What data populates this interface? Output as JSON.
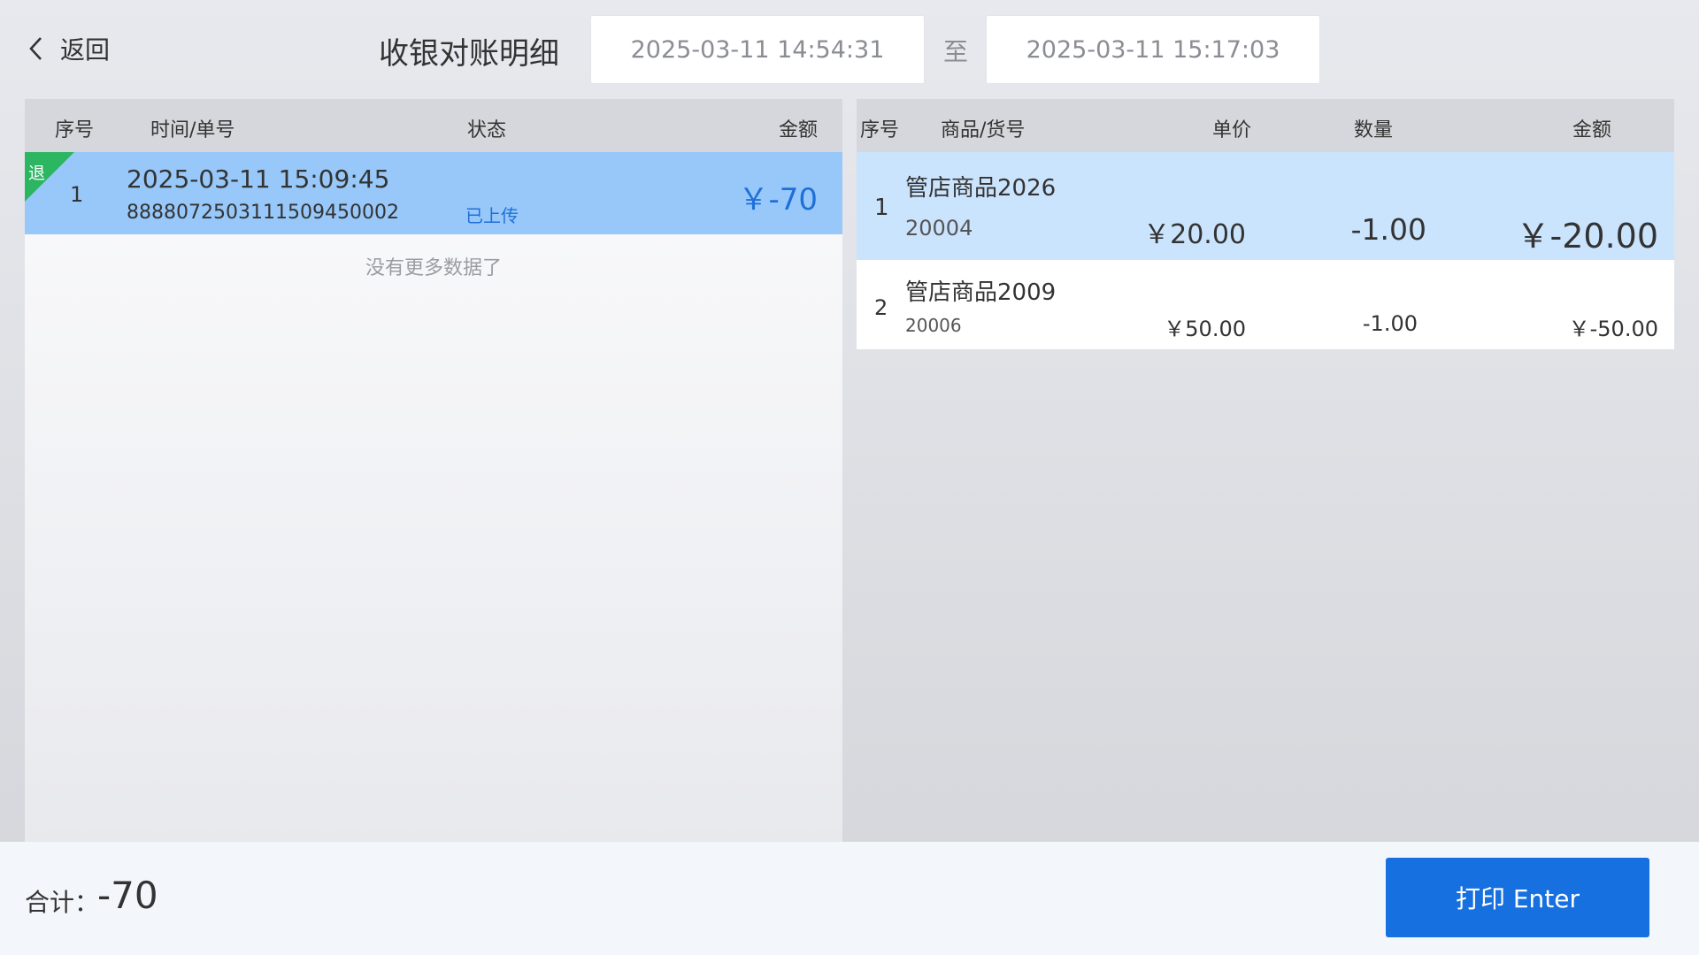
{
  "header": {
    "back_label": "返回",
    "title": "收银对账明细",
    "start_time": "2025-03-11 14:54:31",
    "to_label": "至",
    "end_time": "2025-03-11 15:17:03"
  },
  "orders": {
    "columns": {
      "seq": "序号",
      "time_no": "时间/单号",
      "status": "状态",
      "amount": "金额"
    },
    "rows": [
      {
        "tag": "退",
        "seq": "1",
        "time": "2025-03-11 15:09:45",
        "order_no": "888807250311150945000​2",
        "status": "已上传",
        "amount": "￥-70",
        "selected": true
      }
    ],
    "empty_hint": "没有更多数据了"
  },
  "items": {
    "columns": {
      "seq": "序号",
      "name_code": "商品/货号",
      "price": "单价",
      "qty": "数量",
      "amount": "金额"
    },
    "rows": [
      {
        "seq": "1",
        "name": "管店商品2026",
        "code": "20004",
        "price": "￥20.00",
        "qty": "-1.00",
        "amount": "￥-20.00",
        "selected": true
      },
      {
        "seq": "2",
        "name": "管店商品2009",
        "code": "20006",
        "price": "￥50.00",
        "qty": "-1.00",
        "amount": "￥-50.00",
        "selected": false
      }
    ]
  },
  "footer": {
    "total_label": "合计：",
    "total_value": "-70",
    "print_label": "打印 Enter"
  },
  "colors": {
    "accent": "#1670e0",
    "selected_row": "#97c8f9",
    "refund_tag": "#2cb662"
  }
}
